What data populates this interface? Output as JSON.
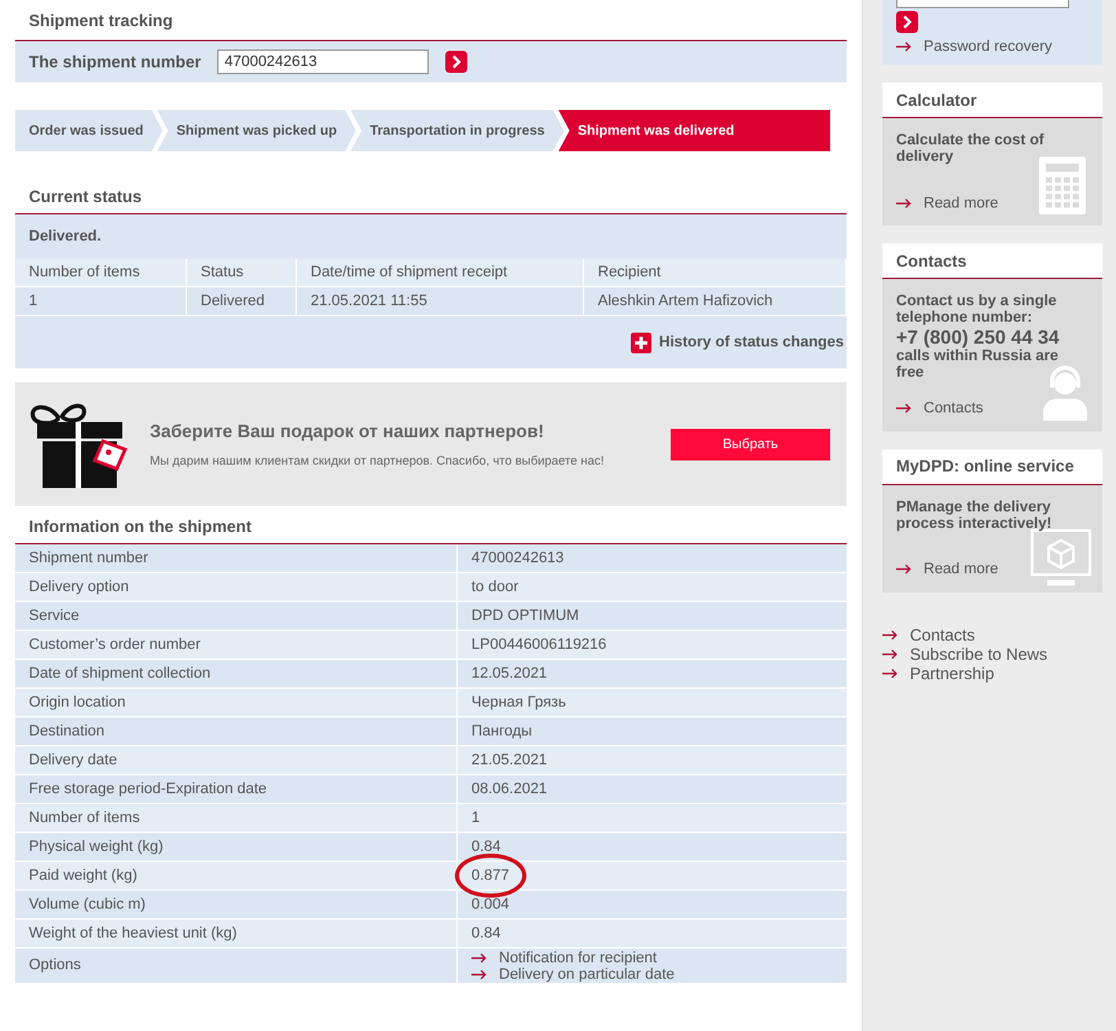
{
  "tracking": {
    "title": "Shipment tracking",
    "number_label": "The shipment number",
    "number_value": "47000242613"
  },
  "steps": [
    {
      "label": "Order was issued",
      "selected": false
    },
    {
      "label": "Shipment was picked up",
      "selected": false
    },
    {
      "label": "Transportation in progress",
      "selected": false
    },
    {
      "label": "Shipment was delivered",
      "selected": true
    }
  ],
  "current_status": {
    "title": "Current status",
    "summary": "Delivered.",
    "columns": [
      "Number of items",
      "Status",
      "Date/time of shipment receipt",
      "Recipient"
    ],
    "rows": [
      [
        "1",
        "Delivered",
        "21.05.2021 11:55",
        "Aleshkin Artem Hafizovich"
      ]
    ],
    "history_link": "History of status changes"
  },
  "banner": {
    "title": "Заберите Ваш подарок от наших партнеров!",
    "text": "Мы дарим нашим клиентам скидки от партнеров. Спасибо, что выбираете нас!",
    "button": "Выбрать"
  },
  "info": {
    "title": "Information on the shipment",
    "rows": [
      {
        "label": "Shipment number",
        "values": [
          "47000242613"
        ],
        "highlighted": false
      },
      {
        "label": "Delivery option",
        "values": [
          "to door"
        ],
        "highlighted": false
      },
      {
        "label": "Service",
        "values": [
          "DPD OPTIMUM"
        ],
        "highlighted": false
      },
      {
        "label": "Customer’s order number",
        "values": [
          "LP00446006119216"
        ],
        "highlighted": false
      },
      {
        "label": "Date of shipment collection",
        "values": [
          "12.05.2021"
        ],
        "highlighted": false
      },
      {
        "label": "Origin location",
        "values": [
          "Черная Грязь"
        ],
        "highlighted": false
      },
      {
        "label": "Destination",
        "values": [
          "Пангоды"
        ],
        "highlighted": false
      },
      {
        "label": "Delivery date",
        "values": [
          "21.05.2021"
        ],
        "highlighted": false
      },
      {
        "label": "Free storage period-Expiration date",
        "values": [
          "08.06.2021"
        ],
        "highlighted": false
      },
      {
        "label": "Number of items",
        "values": [
          "1"
        ],
        "highlighted": false
      },
      {
        "label": "Physical weight (kg)",
        "values": [
          "0.84"
        ],
        "highlighted": false
      },
      {
        "label": "Paid weight (kg)",
        "values": [
          "0.877"
        ],
        "highlighted": true
      },
      {
        "label": "Volume (cubic m)",
        "values": [
          "0.004"
        ],
        "highlighted": false
      },
      {
        "label": "Weight of the heaviest unit (kg)",
        "values": [
          "0.84"
        ],
        "highlighted": false
      },
      {
        "label": "Options",
        "kind": "links",
        "values": [
          "Notification for recipient",
          "Delivery on particular date"
        ],
        "highlighted": false
      }
    ]
  },
  "sidebar": {
    "password_recovery": "Password recovery",
    "panels": [
      {
        "kind": "calculator",
        "title": "Calculator",
        "text": "Calculate the cost of delivery",
        "link": "Read more"
      },
      {
        "kind": "contacts",
        "title": "Contacts",
        "text": "Contact us by a single telephone number:",
        "phone": "+7 (800) 250 44 34",
        "note": "calls within Russia are free",
        "link": "Contacts"
      },
      {
        "kind": "service",
        "title": "MyDPD: online service",
        "text": "PManage the delivery process interactively!",
        "link": "Read more"
      }
    ],
    "links": [
      "Contacts",
      "Subscribe to News",
      "Partnership"
    ]
  }
}
